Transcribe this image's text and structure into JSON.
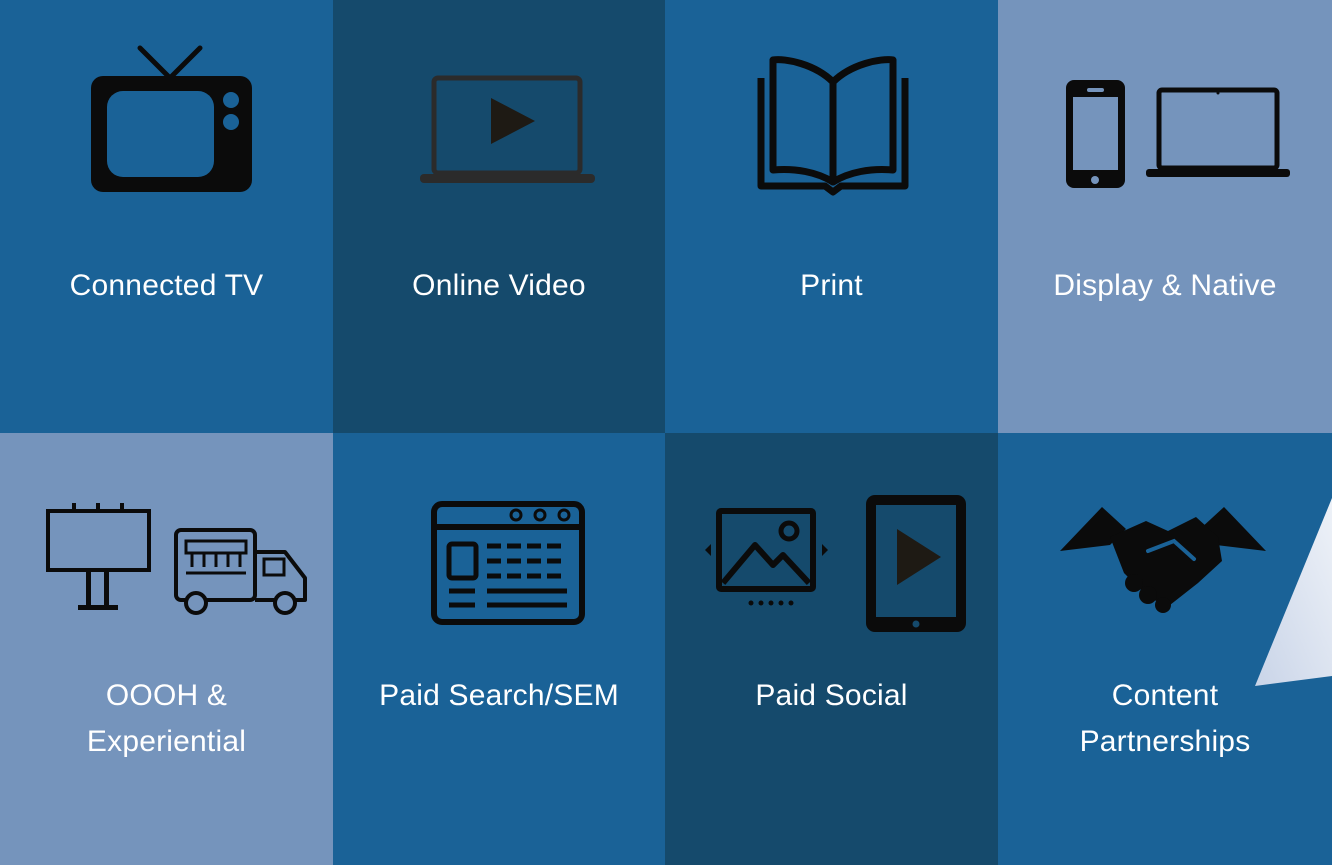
{
  "colors": {
    "tile_mid": "#1a6297",
    "tile_dark": "#154a6c",
    "tile_light": "#7594bc",
    "icon": "#0b0b0b",
    "label": "#ffffff",
    "accent": "#dfe6f2"
  },
  "tiles": [
    {
      "label": "Connected TV",
      "icon": "tv-icon",
      "tone": "tile_mid"
    },
    {
      "label": "Online Video",
      "icon": "laptop-play-icon",
      "tone": "tile_dark"
    },
    {
      "label": "Print",
      "icon": "open-book-icon",
      "tone": "tile_mid"
    },
    {
      "label": "Display & Native",
      "icon": "phone-laptop-icon",
      "tone": "tile_light"
    },
    {
      "label_lines": [
        "OOOH &",
        "Experiential"
      ],
      "icon": "billboard-truck-icon",
      "tone": "tile_light"
    },
    {
      "label": "Paid Search/SEM",
      "icon": "browser-window-icon",
      "tone": "tile_mid"
    },
    {
      "label": "Paid Social",
      "icon": "image-tablet-icon",
      "tone": "tile_dark"
    },
    {
      "label_lines": [
        "Content",
        "Partnerships"
      ],
      "icon": "handshake-icon",
      "tone": "tile_mid"
    }
  ]
}
